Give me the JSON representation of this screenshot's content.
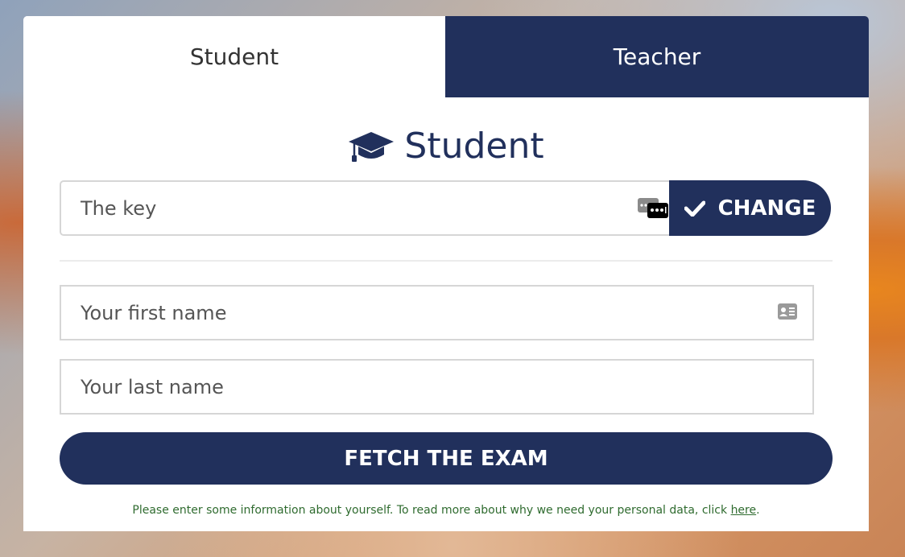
{
  "tabs": [
    {
      "label": "Student",
      "active": true
    },
    {
      "label": "Teacher",
      "active": false
    }
  ],
  "form": {
    "heading": "Student",
    "heading_icon": "graduation-cap-icon",
    "key_placeholder": "The key",
    "change_label": "CHANGE",
    "first_name_placeholder": "Your first name",
    "last_name_placeholder": "Your last name",
    "submit_label": "FETCH THE EXAM"
  },
  "footer": {
    "note_text": "Please enter some information about yourself. To read more about why we need your personal data, click ",
    "link_text": "here",
    "note_end": "."
  },
  "colors": {
    "primary": "#21305c",
    "note": "#2f6b2f",
    "border": "#d6d6d6"
  }
}
